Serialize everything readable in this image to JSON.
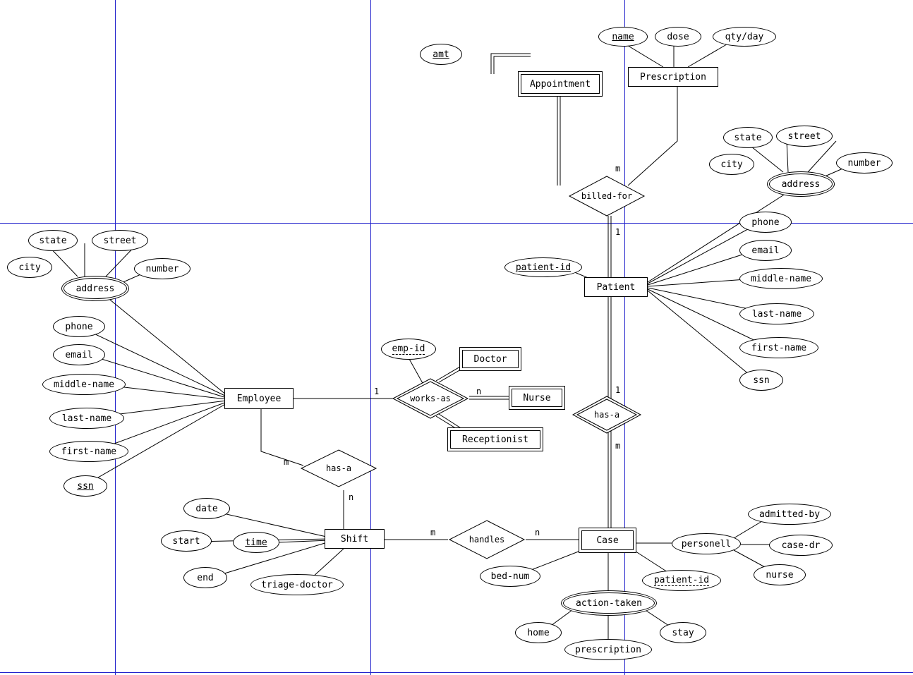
{
  "entities": {
    "appointment": "Appointment",
    "prescription": "Prescription",
    "employee": "Employee",
    "doctor": "Doctor",
    "nurse": "Nurse",
    "receptionist": "Receptionist",
    "patient": "Patient",
    "shift": "Shift",
    "case": "Case"
  },
  "relations": {
    "billed_for": "billed-for",
    "works_as": "works-as",
    "has_a_emp": "has-a",
    "has_a_pat": "has-a",
    "handles": "handles"
  },
  "attrs": {
    "amt": "amt",
    "name": "name",
    "dose": "dose",
    "qty": "qty/day",
    "emp_state": "state",
    "emp_street": "street",
    "emp_city": "city",
    "emp_number": "number",
    "emp_address": "address",
    "emp_phone": "phone",
    "emp_email": "email",
    "emp_middle": "middle-name",
    "emp_last": "last-name",
    "emp_first": "first-name",
    "emp_ssn": "ssn",
    "emp_id": "emp-id",
    "patient_id": "patient-id",
    "pat_state": "state",
    "pat_street": "street",
    "pat_city": "city",
    "pat_number": "number",
    "pat_address": "address",
    "pat_phone": "phone",
    "pat_email": "email",
    "pat_middle": "middle-name",
    "pat_last": "last-name",
    "pat_first": "first-name",
    "pat_ssn": "ssn",
    "shift_date": "date",
    "shift_start": "start",
    "shift_time": "time",
    "shift_end": "end",
    "shift_triage": "triage-doctor",
    "case_bed": "bed-num",
    "case_personell": "personell",
    "case_admitted": "admitted-by",
    "case_dr": "case-dr",
    "case_nurse": "nurse",
    "case_patient_id": "patient-id",
    "case_action": "action-taken",
    "case_home": "home",
    "case_prescription": "prescription",
    "case_stay": "stay"
  },
  "cards": {
    "billed_m": "m",
    "billed_1": "1",
    "works_1": "1",
    "works_n": "n",
    "hasemp_m": "m",
    "hasemp_n": "n",
    "handles_m": "m",
    "handles_n": "n",
    "haspat_1": "1",
    "haspat_m": "m"
  }
}
